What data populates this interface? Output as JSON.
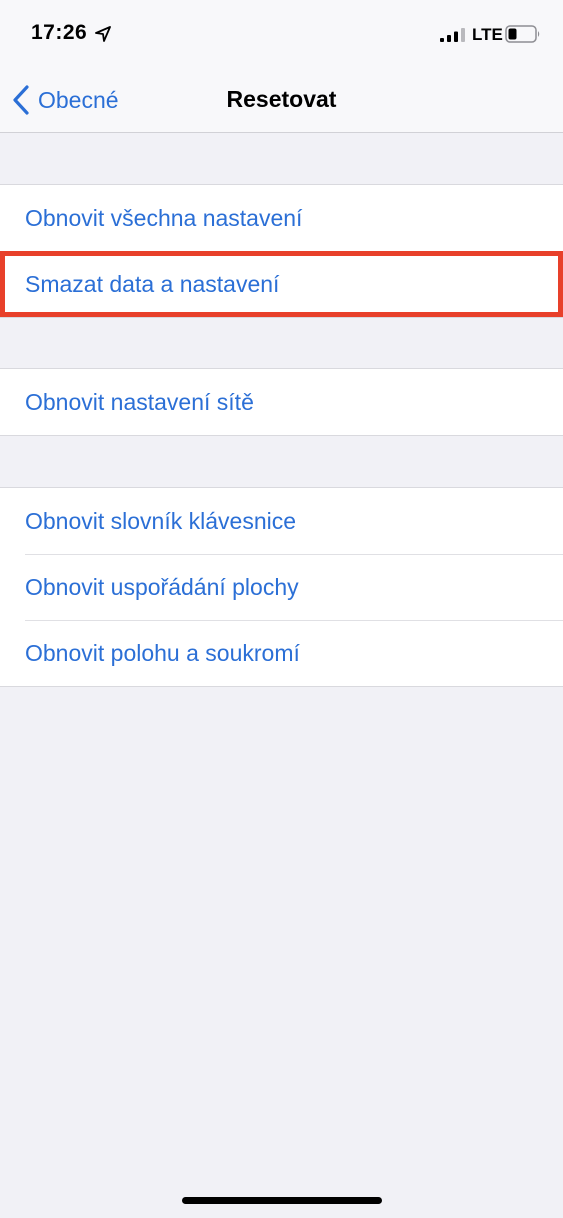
{
  "status_bar": {
    "time": "17:26",
    "network": "LTE",
    "icons": [
      "location-arrow-icon",
      "signal-icon",
      "battery-icon"
    ]
  },
  "nav": {
    "back_label": "Obecné",
    "title": "Resetovat"
  },
  "groups": [
    {
      "items": [
        {
          "label": "Obnovit všechna nastavení"
        },
        {
          "label": "Smazat data a nastavení",
          "highlighted": true
        }
      ]
    },
    {
      "items": [
        {
          "label": "Obnovit nastavení sítě"
        }
      ]
    },
    {
      "items": [
        {
          "label": "Obnovit slovník klávesnice"
        },
        {
          "label": "Obnovit uspořádání plochy"
        },
        {
          "label": "Obnovit polohu a soukromí"
        }
      ]
    }
  ],
  "colors": {
    "accent": "#2b6fd6",
    "highlight_border": "#e8402a",
    "background": "#f1f1f6"
  }
}
